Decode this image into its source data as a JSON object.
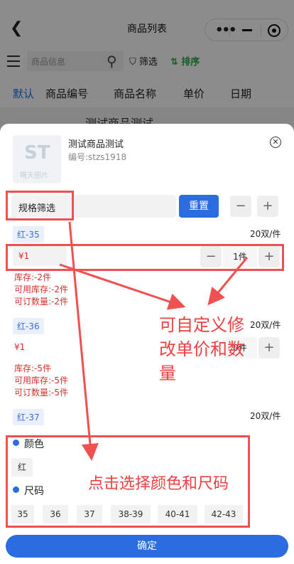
{
  "header": {
    "title": "商品列表",
    "back_icon": "chevron-left-icon",
    "menu_icon": "more-dots-icon",
    "minimize_icon": "minus-icon",
    "close_icon": "target-icon"
  },
  "toolbar": {
    "search_placeholder": "商品信息",
    "filter_label": "筛选",
    "sort_label": "排序",
    "sort_color": "#2aa84a"
  },
  "tabs": [
    "默认",
    "商品编号",
    "商品名称",
    "单价",
    "日期"
  ],
  "background_item": "测试商品测试",
  "product": {
    "name": "测试商品测试",
    "code": "编号:stzs1918",
    "thumb_text": "曙天图片"
  },
  "spec_filter": {
    "label": "规格筛选",
    "reset_label": "重置",
    "minus": "−",
    "plus": "+"
  },
  "variants": [
    {
      "color": "红-35",
      "pack": "20双/件",
      "price": "¥1",
      "qty": "1件",
      "stock": "库存:-2件",
      "available": "可用库存:-2件",
      "orderable": "可订数量:-2件"
    },
    {
      "color": "红-36",
      "pack": "20双/件",
      "price": "¥1",
      "qty": "0件",
      "stock": "库存:-5件",
      "available": "可用库存:-5件",
      "orderable": "可订数量:-5件"
    },
    {
      "color": "红-37",
      "pack": "20双/件"
    }
  ],
  "color_section": {
    "title": "颜色",
    "options": [
      "红"
    ]
  },
  "size_section": {
    "title": "尺码",
    "options": [
      "35",
      "36",
      "37",
      "38-39",
      "40-41",
      "42-43"
    ]
  },
  "confirm_label": "确定",
  "annotations": {
    "edit_note": "可自定义修改单价和数量",
    "select_note": "点击选择颜色和尺码"
  },
  "colors": {
    "accent": "#2b6de0",
    "annotation": "#f05050",
    "price": "#d9302b"
  }
}
